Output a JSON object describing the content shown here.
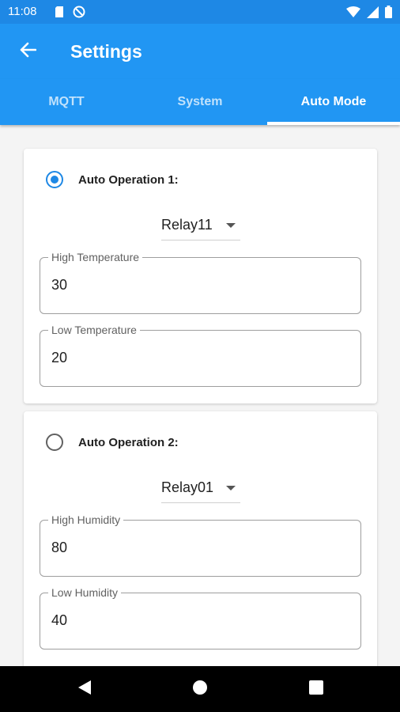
{
  "status_bar": {
    "time": "11:08",
    "icons": [
      "sd-card-icon",
      "sync-off-icon",
      "wifi-icon",
      "signal-icon",
      "battery-icon"
    ]
  },
  "app_bar": {
    "title": "Settings",
    "back_icon": "arrow-back-icon",
    "color": "#2196f3"
  },
  "tabs": [
    {
      "label": "MQTT",
      "active": false
    },
    {
      "label": "System",
      "active": false
    },
    {
      "label": "Auto Mode",
      "active": true
    }
  ],
  "operations": [
    {
      "label": "Auto Operation 1:",
      "selected": true,
      "relay": "Relay11",
      "fields": [
        {
          "label": "High Temperature",
          "value": "30"
        },
        {
          "label": "Low Temperature",
          "value": "20"
        }
      ]
    },
    {
      "label": "Auto Operation 2:",
      "selected": false,
      "relay": "Relay01",
      "fields": [
        {
          "label": "High Humidity",
          "value": "80"
        },
        {
          "label": "Low Humidity",
          "value": "40"
        }
      ]
    }
  ],
  "nav_bar": {
    "buttons": [
      "back-triangle-icon",
      "home-circle-icon",
      "recents-square-icon"
    ]
  }
}
